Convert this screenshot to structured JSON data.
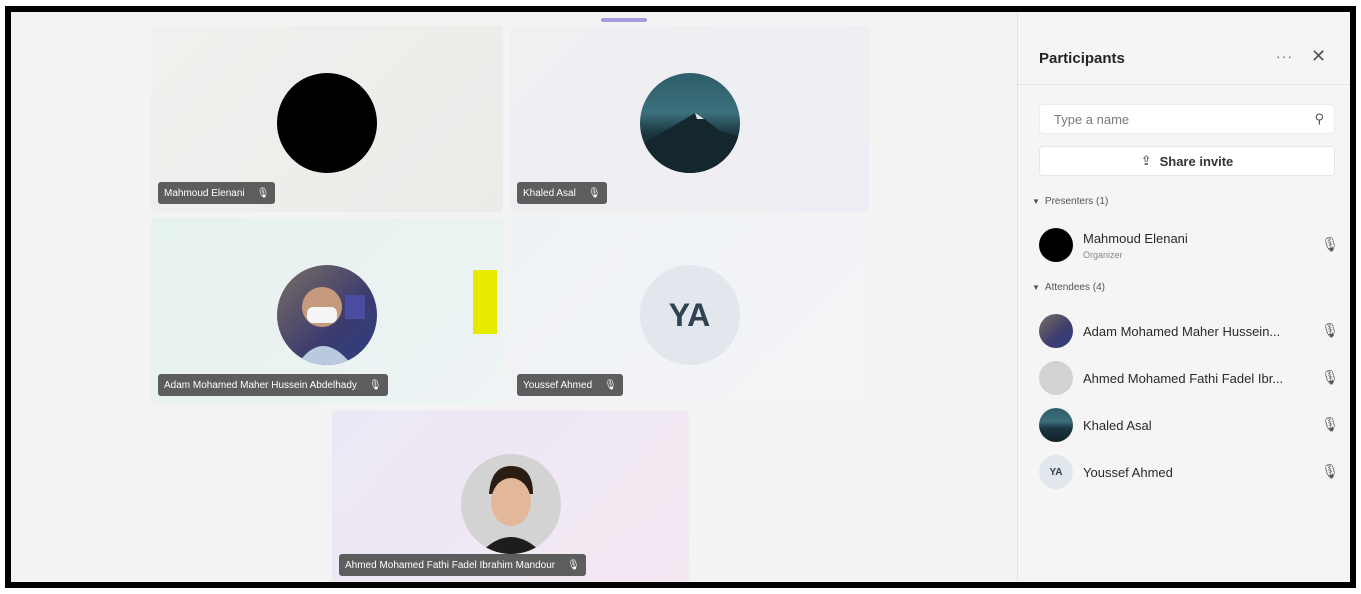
{
  "meeting": {
    "tiles": [
      {
        "name": "Mahmoud Elenani",
        "mic_icon": "mic-muted-icon"
      },
      {
        "name": "Khaled Asal",
        "mic_icon": "mic-muted-icon"
      },
      {
        "name": "Adam Mohamed Maher Hussein Abdelhady",
        "mic_icon": "mic-muted-icon"
      },
      {
        "name": "Youssef Ahmed",
        "initials": "YA",
        "mic_icon": "mic-muted-icon"
      },
      {
        "name": "Ahmed Mohamed Fathi Fadel Ibrahim Mandour",
        "mic_icon": "mic-muted-icon"
      }
    ]
  },
  "panel": {
    "title": "Participants",
    "more_icon": "more-icon",
    "close_icon": "close-icon",
    "search_placeholder": "Type a name",
    "share_label": "Share invite",
    "presenters_label": "Presenters (1)",
    "attendees_label": "Attendees (4)",
    "presenters": [
      {
        "name": "Mahmoud Elenani",
        "role": "Organizer"
      }
    ],
    "attendees": [
      {
        "name": "Adam Mohamed Maher Hussein..."
      },
      {
        "name": "Ahmed Mohamed Fathi Fadel Ibr..."
      },
      {
        "name": "Khaled Asal"
      },
      {
        "name": "Youssef Ahmed",
        "initials": "YA"
      }
    ]
  },
  "colors": {
    "name_tag_bg": "#5d5d5d",
    "accent_marker": "#a49be0",
    "yellow_block": "#e6ea00"
  }
}
